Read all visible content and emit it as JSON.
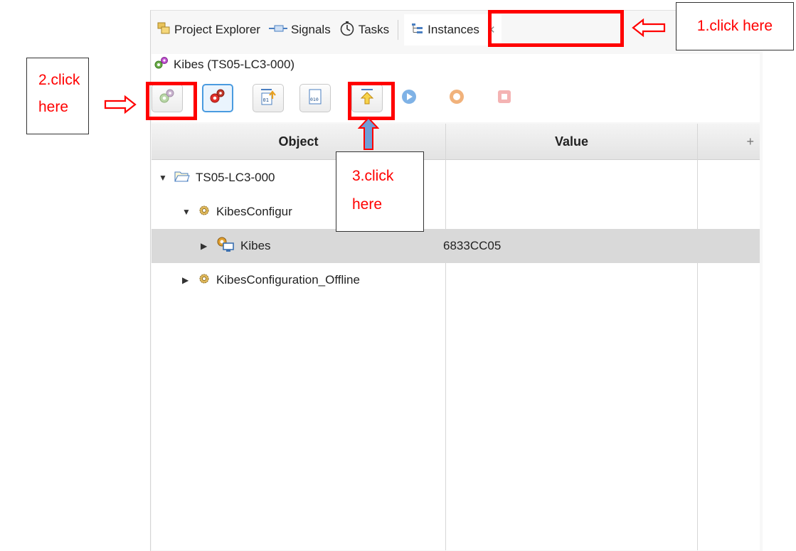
{
  "tabs": [
    {
      "label": "Project Explorer",
      "icon": "project-explorer-icon"
    },
    {
      "label": "Signals",
      "icon": "signals-icon"
    },
    {
      "label": "Tasks",
      "icon": "tasks-stopwatch-icon"
    },
    {
      "label": "Instances",
      "icon": "instances-tree-icon",
      "active": true
    }
  ],
  "instance_header": {
    "label": "Kibes (TS05-LC3-000)",
    "icon": "gears-icon"
  },
  "toolbar": {
    "buttons": [
      {
        "icon": "gears-disabled-icon",
        "enabled": false
      },
      {
        "icon": "gears-red-icon",
        "enabled": true
      },
      {
        "icon": "upload-binary-icon",
        "enabled": true
      },
      {
        "icon": "binary-file-icon",
        "enabled": true
      },
      {
        "icon": "upload-arrow-icon",
        "enabled": true
      },
      {
        "icon": "play-icon",
        "enabled": false
      },
      {
        "icon": "record-icon",
        "enabled": false
      },
      {
        "icon": "stop-icon",
        "enabled": false
      }
    ]
  },
  "table": {
    "columns": [
      "Object",
      "Value",
      "+"
    ],
    "rows": [
      {
        "label": "TS05-LC3-000",
        "value": "",
        "expanded": true,
        "icon": "folder-open-icon"
      },
      {
        "label": "KibesConfigur",
        "value": "",
        "expanded": true,
        "icon": "config-gear-icon"
      },
      {
        "label": "Kibes",
        "value": "6833CC05",
        "expanded": false,
        "icon": "device-icon",
        "selected": true
      },
      {
        "label": "KibesConfiguration_Offline",
        "value": "",
        "expanded": false,
        "icon": "config-gear-icon"
      }
    ]
  },
  "callouts": {
    "step1": "1.click here",
    "step2_line1": "2.click",
    "step2_line2": "here",
    "step3_line1": "3.click",
    "step3_line2": "here"
  },
  "colors": {
    "annotation_red": "#ff0000",
    "selection_blue": "#4a9be0",
    "row_highlight": "#d9d9d9"
  }
}
